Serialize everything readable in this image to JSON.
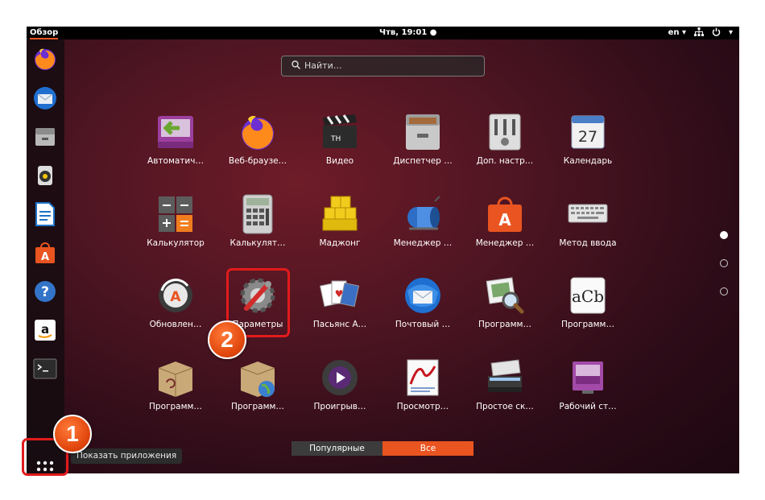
{
  "topbar": {
    "activities": "Обзор",
    "clock": "Чтв, 19:01 ●",
    "language": "en ▾",
    "network_icon": "network-icon",
    "power_icon": "power-icon",
    "power_arrow": "▾"
  },
  "dock": {
    "items": [
      {
        "name": "firefox-icon"
      },
      {
        "name": "thunderbird-icon"
      },
      {
        "name": "files-icon"
      },
      {
        "name": "rhythmbox-icon"
      },
      {
        "name": "libreoffice-writer-icon"
      },
      {
        "name": "software-center-icon"
      },
      {
        "name": "help-icon"
      },
      {
        "name": "amazon-icon"
      },
      {
        "name": "terminal-icon"
      }
    ],
    "show_apps_tooltip": "Показать приложения"
  },
  "search": {
    "placeholder": "Найти…"
  },
  "apps": [
    {
      "label": "Автоматич…",
      "icon": "auto-import-icon"
    },
    {
      "label": "Веб-браузе…",
      "icon": "firefox-icon"
    },
    {
      "label": "Видео",
      "icon": "video-clapper-icon"
    },
    {
      "label": "Диспетчер …",
      "icon": "archive-manager-icon"
    },
    {
      "label": "Доп. настр…",
      "icon": "tweaks-icon"
    },
    {
      "label": "Календарь",
      "icon": "calendar-icon"
    },
    {
      "label": "Калькулятор",
      "icon": "calculator-icon"
    },
    {
      "label": "Калькулят…",
      "icon": "calculator-classic-icon"
    },
    {
      "label": "Маджонг",
      "icon": "mahjong-icon"
    },
    {
      "label": "Менеджер …",
      "icon": "printer-manager-icon"
    },
    {
      "label": "Менеджер …",
      "icon": "software-manager-icon"
    },
    {
      "label": "Метод ввода",
      "icon": "keyboard-icon"
    },
    {
      "label": "Обновлен…",
      "icon": "update-icon"
    },
    {
      "label": "Параметры",
      "icon": "settings-icon"
    },
    {
      "label": "Пасьянс А…",
      "icon": "solitaire-icon"
    },
    {
      "label": "Почтовый …",
      "icon": "mail-icon"
    },
    {
      "label": "Программ…",
      "icon": "image-viewer-icon"
    },
    {
      "label": "Программ…",
      "icon": "font-viewer-icon"
    },
    {
      "label": "Программ…",
      "icon": "package-installer-icon"
    },
    {
      "label": "Программ…",
      "icon": "package-globe-icon"
    },
    {
      "label": "Проигрыв…",
      "icon": "media-player-icon"
    },
    {
      "label": "Просмотр…",
      "icon": "document-viewer-icon"
    },
    {
      "label": "Простое ск…",
      "icon": "scanner-icon"
    },
    {
      "label": "Рабочий ст…",
      "icon": "desktop-sharing-icon"
    }
  ],
  "font_viewer_glyph": "aCb",
  "calendar_day": "27",
  "tabs": {
    "popular": "Популярные",
    "all": "Все"
  },
  "annotations": {
    "step1": "1",
    "step2": "2"
  },
  "colors": {
    "accent": "#e95420",
    "annotation_red": "#e21b1b"
  }
}
